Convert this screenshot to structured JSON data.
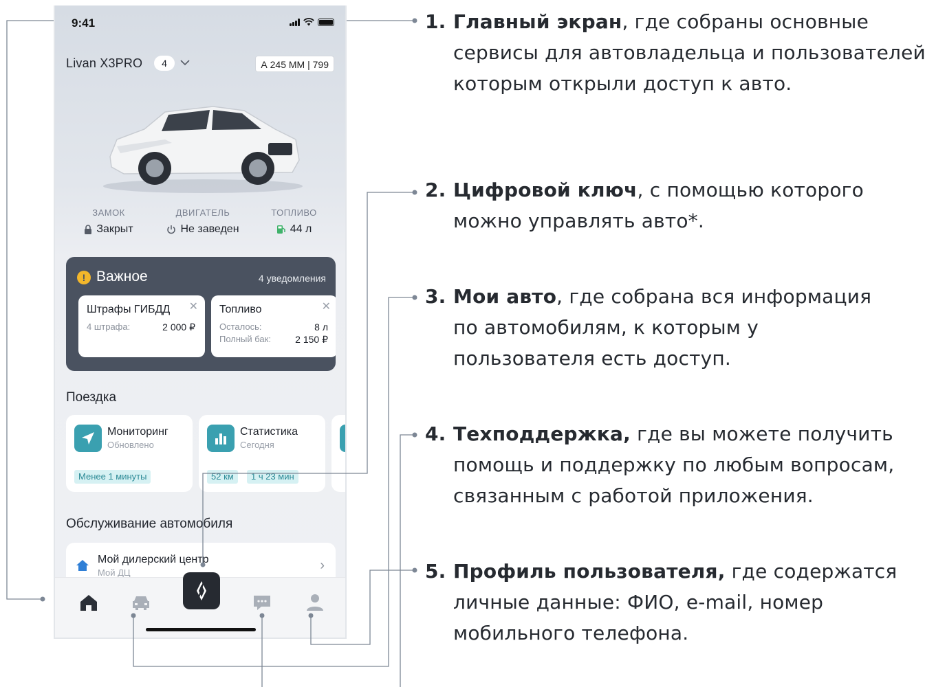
{
  "phone": {
    "status_time": "9:41",
    "car_model": "Livan X3PRO",
    "car_count": "4",
    "plate": "А 245 ММ | 799",
    "stats": [
      {
        "title": "ЗАМОК",
        "value": "Закрыт",
        "icon": "lock-icon"
      },
      {
        "title": "ДВИГАТЕЛЬ",
        "value": "Не заведен",
        "icon": "power-icon"
      },
      {
        "title": "ТОПЛИВО",
        "value": "44 л",
        "icon": "fuel-pump-icon"
      }
    ],
    "important": {
      "title": "Важное",
      "count": "4 уведомления",
      "cards": [
        {
          "title": "Штрафы ГИБДД",
          "rows": [
            {
              "label": "4 штрафа:",
              "value": "2 000 ₽"
            }
          ]
        },
        {
          "title": "Топливо",
          "rows": [
            {
              "label": "Осталось:",
              "value": "8 л"
            },
            {
              "label": "Полный бак:",
              "value": "2 150 ₽"
            }
          ]
        }
      ]
    },
    "trip": {
      "title": "Поездка",
      "cards": [
        {
          "title": "Мониторинг",
          "sub": "Обновлено",
          "chips": [
            "Менее 1 минуты"
          ]
        },
        {
          "title": "Статистика",
          "sub": "Сегодня",
          "chips": [
            "52 км",
            "1 ч 23 мин"
          ]
        }
      ]
    },
    "service": {
      "title": "Обслуживание автомобиля",
      "dealer_title": "Мой дилерский центр",
      "dealer_sub": "Мой ДЦ"
    },
    "tabs": [
      "home-icon",
      "car-icon",
      "digital-key-icon",
      "chat-icon",
      "profile-icon"
    ],
    "accent": "#3aa0b0",
    "dark_panel": "#4a5260"
  },
  "annotations": [
    {
      "num": "1.",
      "bold": "Главный экран",
      "rest": ", где собраны основные сервисы для автовладельца и пользователей, которым открыли доступ к авто."
    },
    {
      "num": "2.",
      "bold": "Цифровой ключ",
      "rest": ", с помощью которого можно управлять авто*."
    },
    {
      "num": "3.",
      "bold": "Мои авто",
      "rest": ", где собрана вся информация по автомобилям, к которым у пользователя есть доступ."
    },
    {
      "num": "4.",
      "bold": "Техподдержка,",
      "rest": " где вы можете получить помощь и поддержку по любым вопросам, связанным с работой приложения."
    },
    {
      "num": "5.",
      "bold": "Профиль пользователя,",
      "rest": " где содержатся личные данные: ФИО, e-mail, номер мобильного телефона."
    }
  ]
}
